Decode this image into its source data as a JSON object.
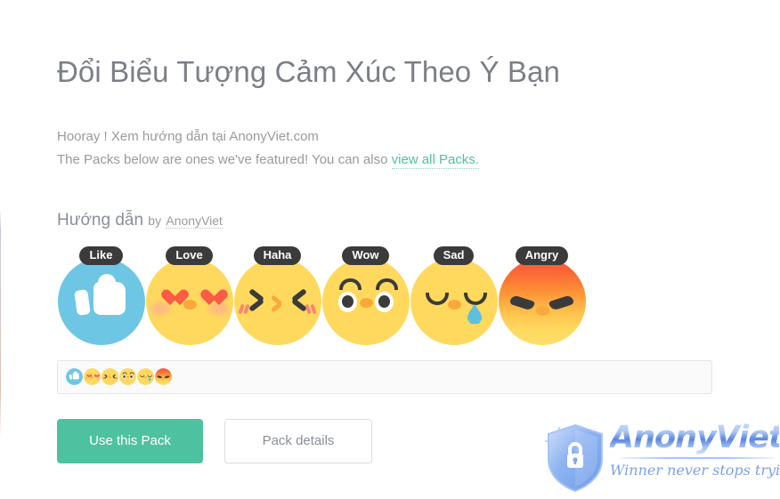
{
  "page": {
    "title": "Đổi Biểu Tượng Cảm Xúc Theo Ý Bạn",
    "intro_line_1": "Hooray ! Xem hướng dẫn tại AnonyViet.com",
    "intro_line_2_before": "The Packs below are ones we've featured! You can also ",
    "intro_line_2_link": "view all Packs.",
    "accent_color": "#4ec2a0"
  },
  "pack": {
    "name": "Hướng dẫn",
    "by_label": "by",
    "author": "AnonyViet",
    "reactions": [
      {
        "label": "Like",
        "kind": "like",
        "color": "#6ec6e5"
      },
      {
        "label": "Love",
        "kind": "love",
        "color": "#ffd95e"
      },
      {
        "label": "Haha",
        "kind": "haha",
        "color": "#ffd95e"
      },
      {
        "label": "Wow",
        "kind": "wow",
        "color": "#ffd95e"
      },
      {
        "label": "Sad",
        "kind": "sad",
        "color": "#ffd95e"
      },
      {
        "label": "Angry",
        "kind": "angry",
        "color": "#f9533a"
      }
    ]
  },
  "buttons": {
    "use_pack": "Use this Pack",
    "pack_details": "Pack details"
  },
  "watermark": {
    "brand": "AnonyViet",
    "tagline": "Winner never stops trying"
  }
}
